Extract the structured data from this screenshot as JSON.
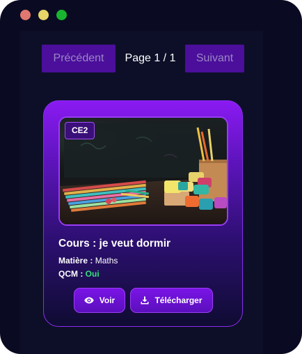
{
  "window": {
    "controls": [
      "close",
      "minimize",
      "maximize"
    ]
  },
  "pagination": {
    "prev_label": "Précédent",
    "page_label": "Page 1 / 1",
    "next_label": "Suivant"
  },
  "card": {
    "badge": "CE2",
    "title": "Cours : je veut dormir",
    "subject_label": "Matière :",
    "subject_value": "Maths",
    "qcm_label": "QCM :",
    "qcm_value": "Oui",
    "view_label": "Voir",
    "download_label": "Télécharger",
    "view_icon": "eye-icon",
    "download_icon": "download-icon"
  },
  "colors": {
    "background": "#0a0b22",
    "accent": "#7a14e6",
    "qcm_yes": "#35e07e"
  }
}
